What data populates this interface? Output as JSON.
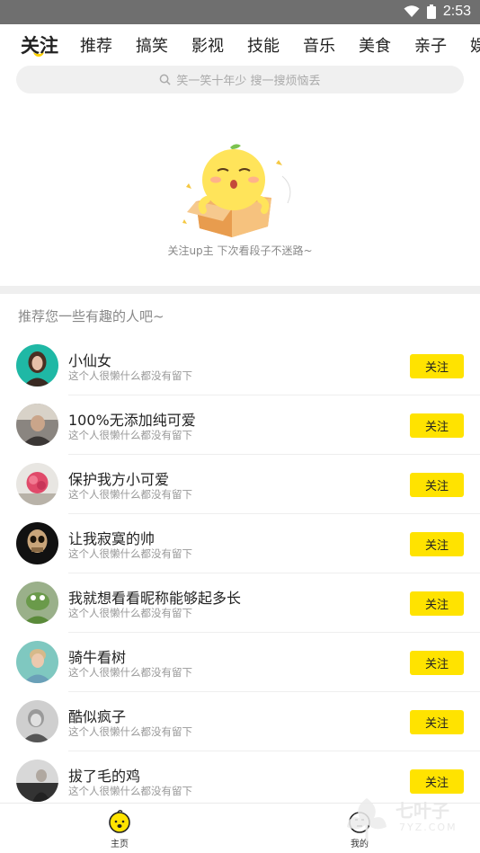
{
  "status_bar": {
    "time": "2:53"
  },
  "tabs": [
    {
      "label": "关注",
      "active": true
    },
    {
      "label": "推荐"
    },
    {
      "label": "搞笑"
    },
    {
      "label": "影视"
    },
    {
      "label": "技能"
    },
    {
      "label": "音乐"
    },
    {
      "label": "美食"
    },
    {
      "label": "亲子"
    },
    {
      "label": "娱"
    }
  ],
  "search": {
    "placeholder": "笑一笑十年少 搜一搜烦恼丢"
  },
  "empty_state": {
    "text": "关注up主 下次看段子不迷路~"
  },
  "recommend": {
    "title": "推荐您一些有趣的人吧~",
    "follow_label": "关注",
    "users": [
      {
        "name": "小仙女",
        "bio": "这个人很懒什么都没有留下"
      },
      {
        "name": "100%无添加纯可爱",
        "bio": "这个人很懒什么都没有留下"
      },
      {
        "name": "保护我方小可爱",
        "bio": "这个人很懒什么都没有留下"
      },
      {
        "name": "让我寂寞的帅",
        "bio": "这个人很懒什么都没有留下"
      },
      {
        "name": "我就想看看昵称能够起多长",
        "bio": "这个人很懒什么都没有留下"
      },
      {
        "name": "骑牛看树",
        "bio": "这个人很懒什么都没有留下"
      },
      {
        "name": "酷似疯子",
        "bio": "这个人很懒什么都没有留下"
      },
      {
        "name": "拔了毛的鸡",
        "bio": "这个人很懒什么都没有留下"
      }
    ]
  },
  "bottom_nav": {
    "home_label": "主页",
    "mine_label": "我的"
  },
  "watermark": {
    "brand": "七叶子",
    "domain": "7YZ.COM"
  },
  "colors": {
    "accent": "#ffe300",
    "status_bar": "#6f6f6f"
  }
}
